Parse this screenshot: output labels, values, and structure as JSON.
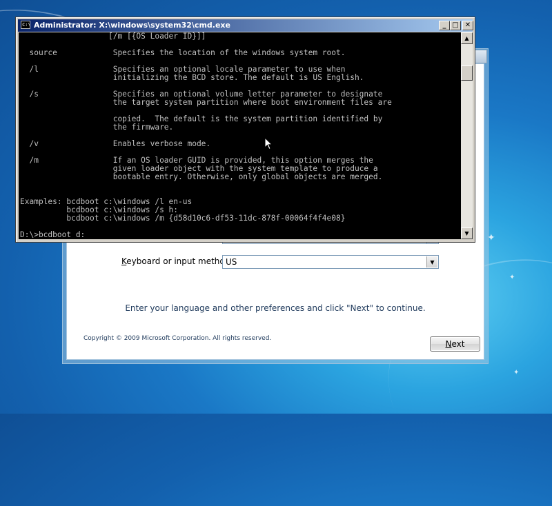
{
  "setup": {
    "keyboard_label_prefix": "",
    "keyboard_label_accel": "K",
    "keyboard_label_rest": "eyboard or input method:",
    "keyboard_value": "US",
    "instruction": "Enter your language and other preferences and click \"Next\" to continue.",
    "copyright": "Copyright © 2009 Microsoft Corporation. All rights reserved.",
    "next_accel": "N",
    "next_rest": "ext"
  },
  "cmd": {
    "title": "Administrator: X:\\windows\\system32\\cmd.exe",
    "icon_text": "C:\\",
    "minimize": "_",
    "maximize": "□",
    "close": "✕",
    "lines": [
      "                   [/m [{OS Loader ID}]]",
      "",
      "  source            Specifies the location of the windows system root.",
      "",
      "  /l                Specifies an optional locale parameter to use when",
      "                    initializing the BCD store. The default is US English.",
      "",
      "  /s                Specifies an optional volume letter parameter to designate",
      "                    the target system partition where boot environment files are",
      "",
      "                    copied.  The default is the system partition identified by",
      "                    the firmware.",
      "",
      "  /v                Enables verbose mode.",
      "",
      "  /m                If an OS loader GUID is provided, this option merges the",
      "                    given loader object with the system template to produce a",
      "                    bootable entry. Otherwise, only global objects are merged.",
      "",
      "",
      "Examples: bcdboot c:\\windows /l en-us",
      "          bcdboot c:\\windows /s h:",
      "          bcdboot c:\\windows /m {d58d10c6-df53-11dc-878f-00064f4f4e08}",
      "",
      "D:\\>bcdboot d:"
    ]
  },
  "icons": {
    "cmd_icon": "console-icon",
    "scroll_up": "▲",
    "scroll_down": "▼",
    "dropdown": "▼"
  },
  "colors": {
    "cmd_title_start": "#0a246a",
    "cmd_title_end": "#a6caf0",
    "console_bg": "#000000",
    "console_text": "#c0c0c0",
    "setup_text": "#1e395b"
  }
}
